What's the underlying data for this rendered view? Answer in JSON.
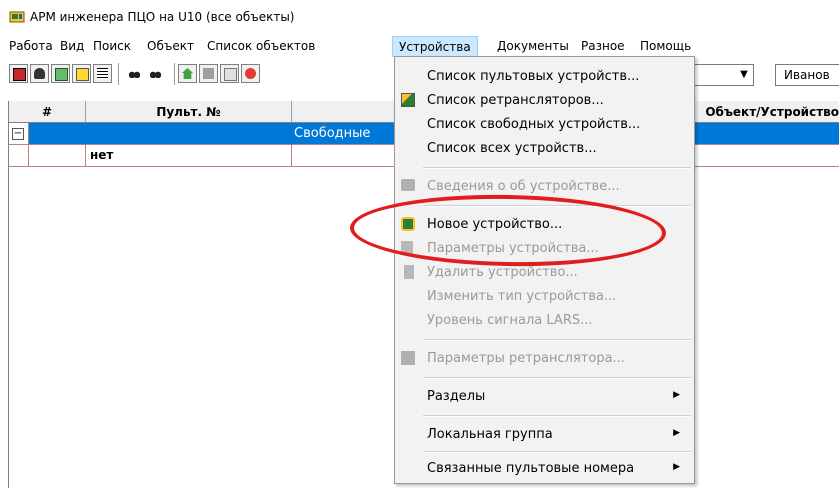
{
  "window": {
    "title": "АРМ инженера ПЦО на U10 (все объекты)"
  },
  "menubar": {
    "items": [
      "Работа",
      "Вид",
      "Поиск",
      "Объект",
      "Список объектов",
      "Устройства",
      "Документы",
      "Разное",
      "Помощь"
    ],
    "active": "Устройства"
  },
  "toolbar": {
    "combo_arrow": "▼",
    "combo2_value": "Иванов"
  },
  "grid": {
    "columns": [
      "#",
      "Пульт. №",
      "",
      "Объект/Устройство"
    ],
    "rows": [
      {
        "expander": "−",
        "num": "",
        "text": "Свободные",
        "selected": true
      },
      {
        "expander": "",
        "num": "нет",
        "text": "",
        "selected": false
      }
    ]
  },
  "devices_menu": {
    "items": [
      {
        "label": "Список пультовых устройств...",
        "disabled": false,
        "icon": ""
      },
      {
        "label": "Список ретрансляторов...",
        "disabled": false,
        "icon": "repeater-list-icon"
      },
      {
        "label": "Список свободных устройств...",
        "disabled": false,
        "icon": ""
      },
      {
        "label": "Список всех устройств...",
        "disabled": false,
        "icon": ""
      },
      {
        "label": "Сведения о об устройстве...",
        "disabled": true,
        "icon": "device-info-icon"
      },
      {
        "label": "Новое устройство...",
        "disabled": false,
        "icon": "new-device-icon"
      },
      {
        "label": "Параметры устройства...",
        "disabled": true,
        "icon": "device-params-icon"
      },
      {
        "label": "Удалить устройство...",
        "disabled": true,
        "icon": "delete-device-icon"
      },
      {
        "label": "Изменить тип устройства...",
        "disabled": true,
        "icon": ""
      },
      {
        "label": "Уровень сигнала LARS...",
        "disabled": true,
        "icon": ""
      },
      {
        "label": "Параметры ретранслятора...",
        "disabled": true,
        "icon": "repeater-params-icon"
      },
      {
        "label": "Разделы",
        "disabled": false,
        "icon": "",
        "submenu": true
      },
      {
        "label": "Локальная группа",
        "disabled": false,
        "icon": "",
        "submenu": true
      },
      {
        "label": "Связанные пультовые номера",
        "disabled": false,
        "icon": "",
        "submenu": true
      }
    ],
    "submenu_arrow": "▶"
  },
  "colors": {
    "selected_row": "#0078d7",
    "menu_highlight": "#cce8ff",
    "annotation": "#e11d1d"
  }
}
